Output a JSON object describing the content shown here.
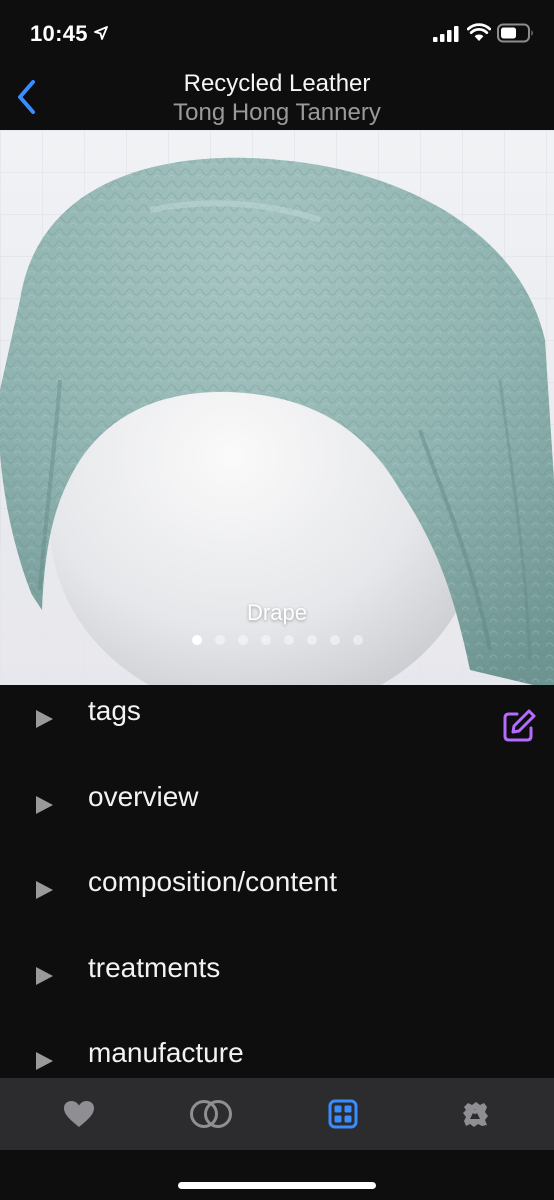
{
  "status_bar": {
    "time": "10:45",
    "location_icon": "location-arrow-icon",
    "signal_icon": "cellular-signal-icon",
    "wifi_icon": "wifi-icon",
    "battery_icon": "battery-icon"
  },
  "nav": {
    "back_icon": "chevron-left-icon",
    "title": "Recycled Leather",
    "subtitle": "Tong Hong Tannery"
  },
  "hero": {
    "caption": "Drape",
    "page_count": 8,
    "active_page": 1
  },
  "sections": [
    {
      "label": "tags"
    },
    {
      "label": "overview"
    },
    {
      "label": "composition/content"
    },
    {
      "label": "treatments"
    },
    {
      "label": "manufacture"
    }
  ],
  "edit_icon": "edit-square-pencil-icon",
  "tab_bar": {
    "tabs": [
      {
        "icon": "heart-icon",
        "active": false
      },
      {
        "icon": "overlap-circles-icon",
        "active": false
      },
      {
        "icon": "grid-icon",
        "active": true
      },
      {
        "icon": "swatch-stamp-icon",
        "active": false
      }
    ]
  },
  "colors": {
    "accent_blue": "#3a8dff",
    "edit_purple": "#b46bff",
    "fabric_teal": "#8fb3b0",
    "background": "#0e0e0e",
    "tab_bar": "#2c2c2e"
  }
}
